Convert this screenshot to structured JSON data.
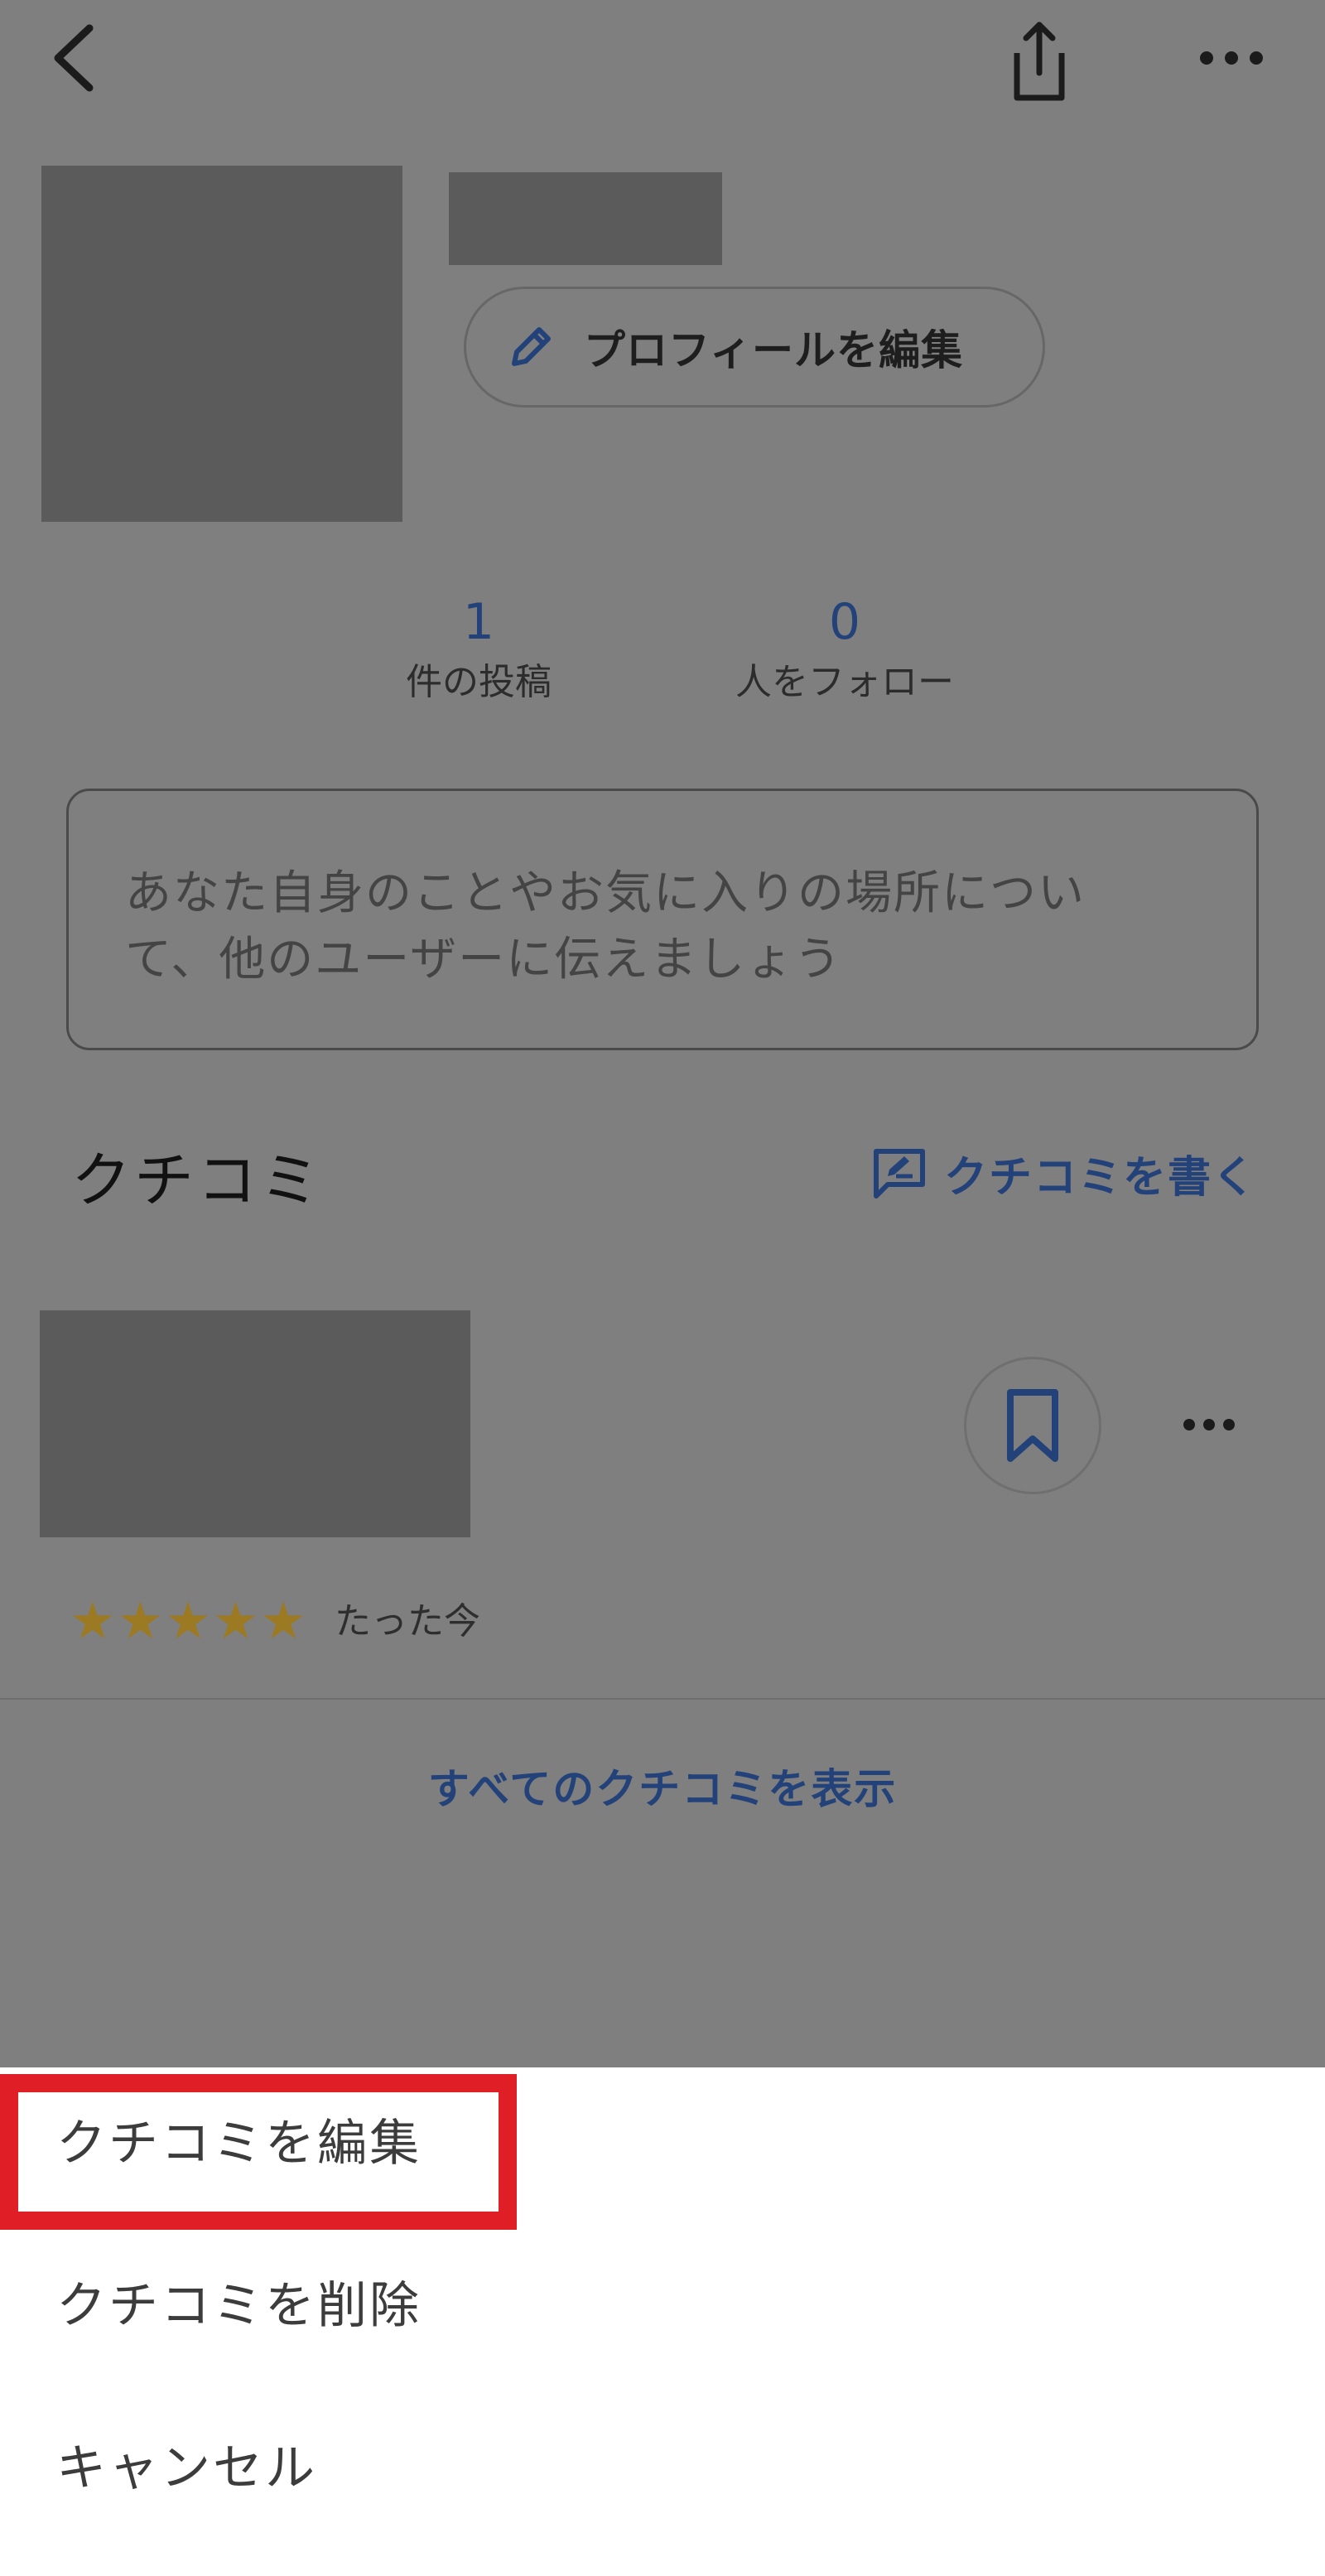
{
  "colors": {
    "overlay_gray": "#7f7f7f",
    "link_blue": "#24427a",
    "star_gold": "#9b7a23",
    "highlight_red": "#e01e25",
    "sheet_bg": "#ffffff"
  },
  "topbar": {
    "back_icon": "chevron-left-icon",
    "share_icon": "share-icon",
    "more_icon": "more-horizontal-icon"
  },
  "profile": {
    "edit_profile_label": "プロフィールを編集",
    "stats": [
      {
        "value": "1",
        "caption": "件の投稿"
      },
      {
        "value": "0",
        "caption": "人をフォロー"
      }
    ],
    "bio_placeholder_line1": "あなた自身のことやお気に入りの場所につい",
    "bio_placeholder_line2": "て、他のユーザーに伝えましょう"
  },
  "reviews": {
    "title": "クチコミ",
    "write_label": "クチコミを書く",
    "items": [
      {
        "rating": 5,
        "time": "たった今"
      }
    ],
    "show_all_label": "すべてのクチコミを表示"
  },
  "action_sheet": {
    "items": [
      {
        "label": "クチコミを編集"
      },
      {
        "label": "クチコミを削除"
      },
      {
        "label": "キャンセル"
      }
    ]
  }
}
